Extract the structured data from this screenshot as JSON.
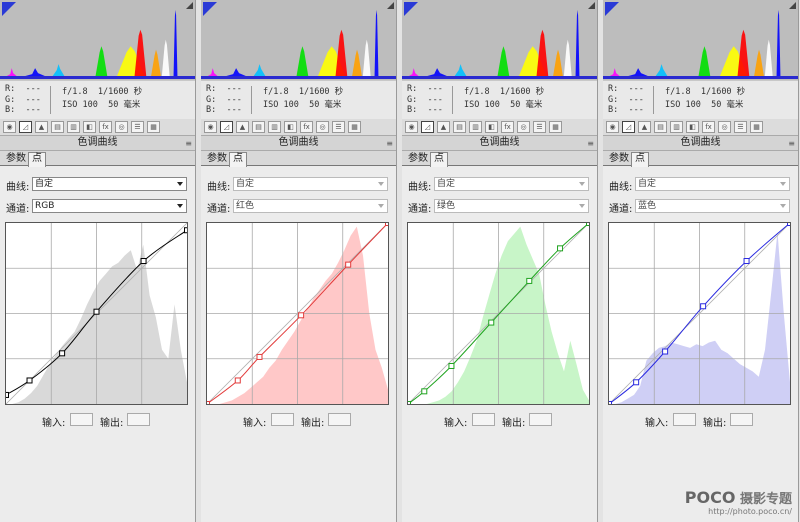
{
  "panels": [
    {
      "info": {
        "r": "R:  ---",
        "g": "G:  ---",
        "b": "B:  ---",
        "aperture": "f/1.8",
        "shutter": "1/1600 秒",
        "iso": "ISO 100",
        "focal": "50 毫米"
      },
      "title": "色调曲线",
      "tabs": [
        "参数",
        "点"
      ],
      "curve_label": "曲线:",
      "curve_value": "自定",
      "channel_label": "通道:",
      "channel_value": "RGB",
      "input_label": "输入:",
      "output_label": "输出:",
      "curve_color": "#000000",
      "hist_color": "#d9d9d9",
      "dim": false
    },
    {
      "info": {
        "r": "R:  ---",
        "g": "G:  ---",
        "b": "B:  ---",
        "aperture": "f/1.8",
        "shutter": "1/1600 秒",
        "iso": "ISO 100",
        "focal": "50 毫米"
      },
      "title": "色调曲线",
      "tabs": [
        "参数",
        "点"
      ],
      "curve_label": "曲线:",
      "curve_value": "自定",
      "channel_label": "通道:",
      "channel_value": "红色",
      "input_label": "输入:",
      "output_label": "输出:",
      "curve_color": "#e23a3a",
      "hist_color": "#ffc8c8",
      "dim": true
    },
    {
      "info": {
        "r": "R:  ---",
        "g": "G:  ---",
        "b": "B:  ---",
        "aperture": "f/1.8",
        "shutter": "1/1600 秒",
        "iso": "ISO 100",
        "focal": "50 毫米"
      },
      "title": "色调曲线",
      "tabs": [
        "参数",
        "点"
      ],
      "curve_label": "曲线:",
      "curve_value": "自定",
      "channel_label": "通道:",
      "channel_value": "绿色",
      "input_label": "输入:",
      "output_label": "输出:",
      "curve_color": "#1fa31f",
      "hist_color": "#c8f5c8",
      "dim": true
    },
    {
      "info": {
        "r": "R:  ---",
        "g": "G:  ---",
        "b": "B:  ---",
        "aperture": "f/1.8",
        "shutter": "1/1600 秒",
        "iso": "ISO 100",
        "focal": "50 毫米"
      },
      "title": "色调曲线",
      "tabs": [
        "参数",
        "点"
      ],
      "curve_label": "曲线:",
      "curve_value": "自定",
      "channel_label": "通道:",
      "channel_value": "蓝色",
      "input_label": "输入:",
      "output_label": "输出:",
      "curve_color": "#2a2ae0",
      "hist_color": "#cfcff5",
      "dim": true
    }
  ],
  "watermark": {
    "logo": "POCO",
    "text": "摄影专题",
    "url": "http://photo.poco.cn/"
  }
}
